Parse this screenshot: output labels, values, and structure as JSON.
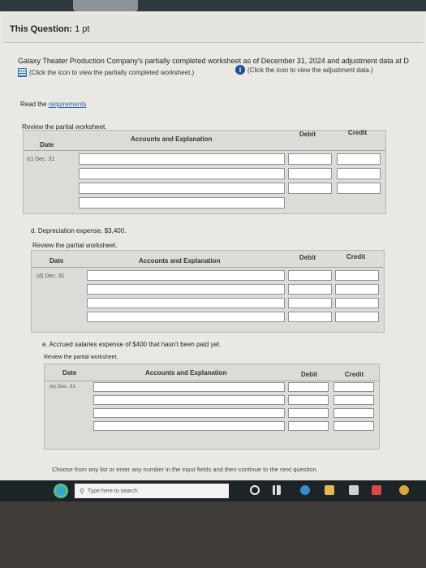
{
  "question": {
    "title": "This Question:",
    "points": "1 pt"
  },
  "intro": {
    "text": "Galaxy Theater Production Company's partially completed worksheet as of December 31, 2024 and adjustment data at D",
    "worksheet_link": "(Click the icon to view the partially completed worksheet.)",
    "adjustment_link": "(Click the icon to view the adjustment data.)",
    "read_prefix": "Read the",
    "requirements_link": "requirements"
  },
  "columns": {
    "date": "Date",
    "accounts": "Accounts and Explanation",
    "debit": "Debit",
    "credit": "Credit"
  },
  "section_c": {
    "review": "Review the partial worksheet.",
    "date": "(c) Dec. 31"
  },
  "section_d": {
    "prompt": "d. Depreciation expense, $3,400.",
    "review": "Review the partial worksheet.",
    "date": "(d) Dec. 31"
  },
  "section_e": {
    "prompt": "e. Accrued salaries expense of $400 that hasn't been paid yet.",
    "review": "Review the partial worksheet.",
    "date": "(e) Dec. 31"
  },
  "footer": {
    "note": "Choose from any list or enter any number in the input fields and then continue to the next question."
  },
  "taskbar": {
    "search_placeholder": "Type here to search"
  }
}
